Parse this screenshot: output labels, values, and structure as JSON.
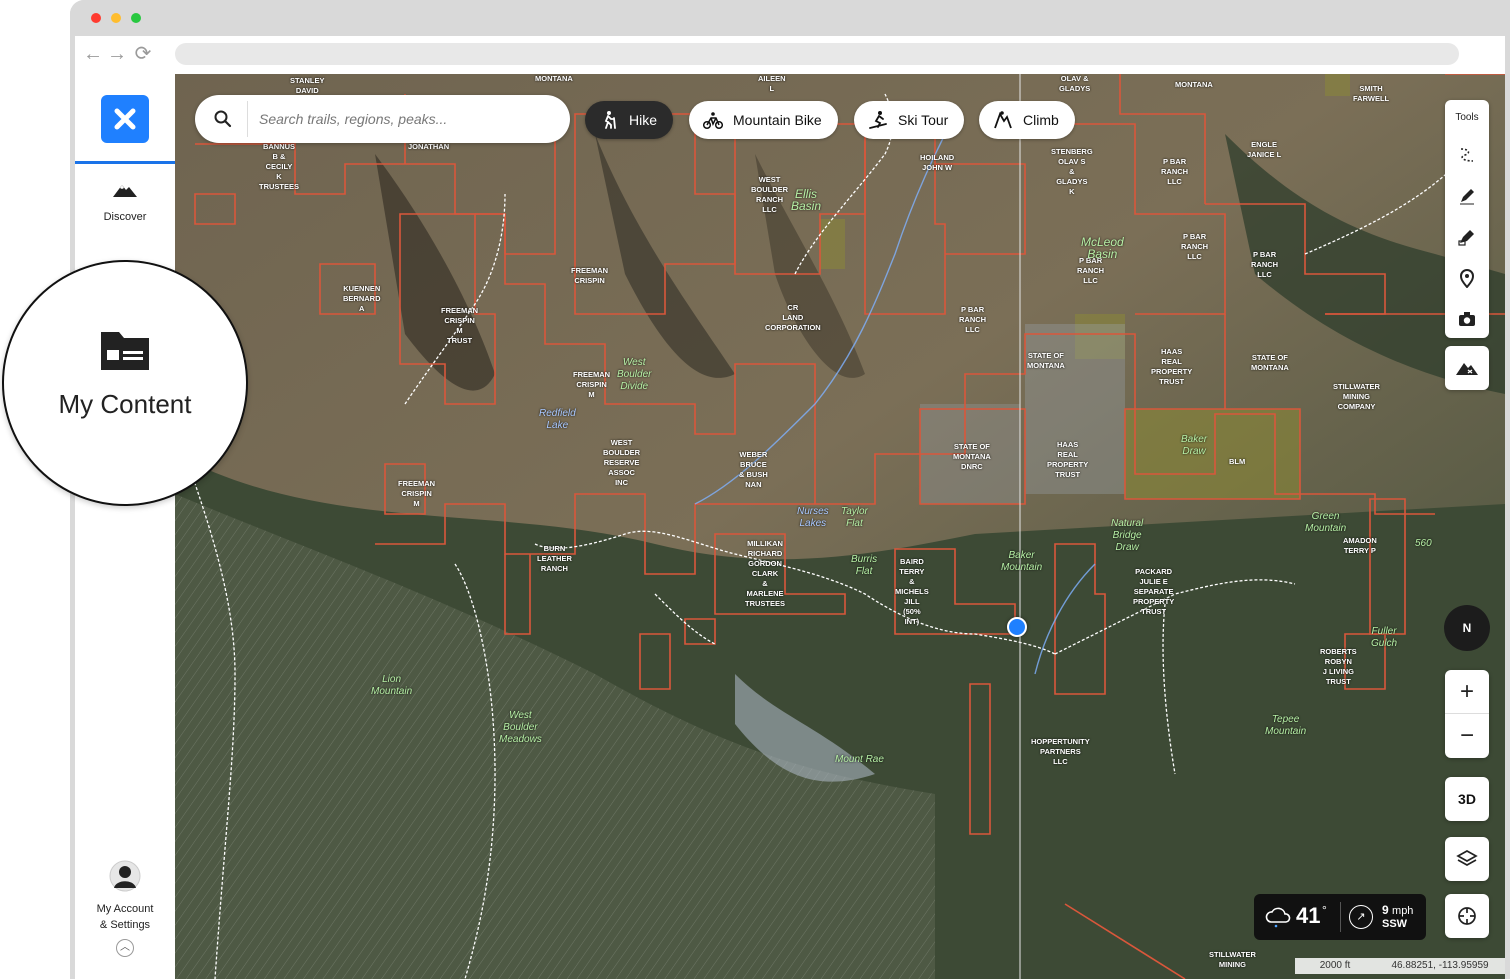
{
  "search": {
    "placeholder": "Search trails, regions, peaks..."
  },
  "activities": [
    {
      "label": "Hike",
      "icon": "hike-icon",
      "active": true
    },
    {
      "label": "Mountain Bike",
      "icon": "mountain-bike-icon",
      "active": false
    },
    {
      "label": "Ski Tour",
      "icon": "ski-tour-icon",
      "active": false
    },
    {
      "label": "Climb",
      "icon": "climb-icon",
      "active": false
    }
  ],
  "sidebar": {
    "discover": "Discover",
    "my_content": "My Content",
    "account_line1": "My Account",
    "account_line2": "& Settings"
  },
  "tools": {
    "title": "Tools"
  },
  "map_controls": {
    "compass": "N",
    "zoom_in": "+",
    "zoom_out": "−",
    "three_d": "3D"
  },
  "weather": {
    "temp": "41",
    "deg": "°",
    "speed": "9",
    "unit": "mph",
    "dir": "SSW"
  },
  "scale": "2000 ft",
  "coords": "46.88251, -113.95959",
  "colors": {
    "accent": "#1f80ff",
    "boundary": "#d9573b",
    "active_chip": "#2b2b2b"
  },
  "map_labels": [
    {
      "t": "STANLEY\nDAVID"
    },
    {
      "t": "MONTANA"
    },
    {
      "t": "AILEEN\nL"
    },
    {
      "t": "OLAV &\nGLADYS"
    },
    {
      "t": "MONTANA"
    },
    {
      "t": "SMITH\nFARWELL"
    },
    {
      "t": "BANNUS\nB &\nCECILY\nK\nTRUSTEES"
    },
    {
      "t": "JONATHAN"
    },
    {
      "t": "HOILAND\nJOHN W"
    },
    {
      "t": "WEST\nBOULDER\nRANCH\nLLC"
    },
    {
      "t": "STENBERG\nOLAV S\n&\nGLADYS\nK"
    },
    {
      "t": "P BAR\nRANCH\nLLC"
    },
    {
      "t": "ENGLE\nJANICE L"
    },
    {
      "t": "P BAR\nRANCH\nLLC"
    },
    {
      "t": "P BAR\nRANCH\nLLC"
    },
    {
      "t": "P BAR\nRANCH\nLLC"
    },
    {
      "t": "KUENNEN\nBERNARD\nA"
    },
    {
      "t": "FREEMAN\nCRISPIN"
    },
    {
      "t": "FREEMAN\nCRISPIN\nM\nTRUST"
    },
    {
      "t": "CR\nLAND\nCORPORATION"
    },
    {
      "t": "P BAR\nRANCH\nLLC"
    },
    {
      "t": "STATE OF\nMONTANA"
    },
    {
      "t": "HAAS\nREAL\nPROPERTY\nTRUST"
    },
    {
      "t": "STATE OF\nMONTANA"
    },
    {
      "t": "STILLWATER\nMINING\nCOMPANY"
    },
    {
      "t": "FREEMAN\nCRISPIN\nM"
    },
    {
      "t": "WEST\nBOULDER\nRESERVE\nASSOC\nINC"
    },
    {
      "t": "WEBER\nBRUCE\n& BUSH\nNAN"
    },
    {
      "t": "STATE OF\nMONTANA\nDNRC"
    },
    {
      "t": "HAAS\nREAL\nPROPERTY\nTRUST"
    },
    {
      "t": "BLM"
    },
    {
      "t": "FREEMAN\nCRISPIN\nM"
    },
    {
      "t": "BURN\nLEATHER\nRANCH"
    },
    {
      "t": "MILLIKAN\nRICHARD\nGORDON\nCLARK\n&\nMARLENE\nTRUSTEES"
    },
    {
      "t": "BAIRD\nTERRY\n&\nMICHELS\nJILL\n(50%\nINT)"
    },
    {
      "t": "PACKARD\nJULIE E\nSEPARATE\nPROPERTY\nTRUST"
    },
    {
      "t": "AMADON\nTERRY P"
    },
    {
      "t": "ROBERTS\nROBYN\nJ LIVING\nTRUST"
    },
    {
      "t": "HOPPERTUNITY\nPARTNERS\nLLC"
    },
    {
      "t": "STILLWATER\nMINING"
    }
  ],
  "place_labels": [
    {
      "t": "Ellis\nBasin"
    },
    {
      "t": "McLeod\nBasin"
    },
    {
      "t": "West\nBoulder\nDivide"
    },
    {
      "t": "Redfield\nLake"
    },
    {
      "t": "Baker\nDraw"
    },
    {
      "t": "Green\nMountain"
    },
    {
      "t": "Taylor\nFlat"
    },
    {
      "t": "Nurses\nLakes"
    },
    {
      "t": "Burris\nFlat"
    },
    {
      "t": "Baker\nMountain"
    },
    {
      "t": "Natural\nBridge\nDraw"
    },
    {
      "t": "Lion\nMountain"
    },
    {
      "t": "West\nBoulder\nMeadows"
    },
    {
      "t": "Mount Rae"
    },
    {
      "t": "Tepee\nMountain"
    },
    {
      "t": "Fuller\nGulch"
    },
    {
      "t": "560"
    }
  ]
}
